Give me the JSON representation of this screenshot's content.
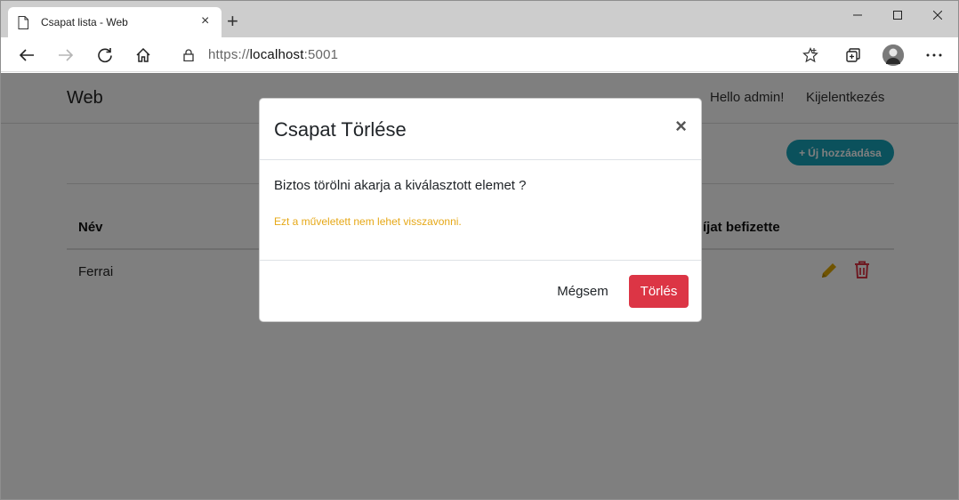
{
  "browser": {
    "tab_title": "Csapat lista - Web",
    "tab_close": "×",
    "new_tab": "+",
    "url_scheme": "https://",
    "url_host": "localhost",
    "url_port": ":5001"
  },
  "navbar": {
    "brand": "Web",
    "greeting": "Hello admin!",
    "logout": "Kijelentkezés"
  },
  "main": {
    "add_button_icon": "+",
    "add_button_label": "Új hozzáadása",
    "table": {
      "headers": [
        "Név",
        "íjat befizette"
      ],
      "rows": [
        {
          "name": "Ferrai"
        }
      ]
    }
  },
  "modal": {
    "title": "Csapat Törlése",
    "close": "×",
    "question": "Biztos törölni akarja a kiválasztott elemet ?",
    "warning": "Ezt a műveletett nem lehet visszavonni.",
    "cancel_label": "Mégsem",
    "delete_label": "Törlés"
  },
  "colors": {
    "accent_info": "#17a2b8",
    "danger": "#dc3545",
    "warning": "#e6a817",
    "edit_icon": "#e0a800"
  }
}
